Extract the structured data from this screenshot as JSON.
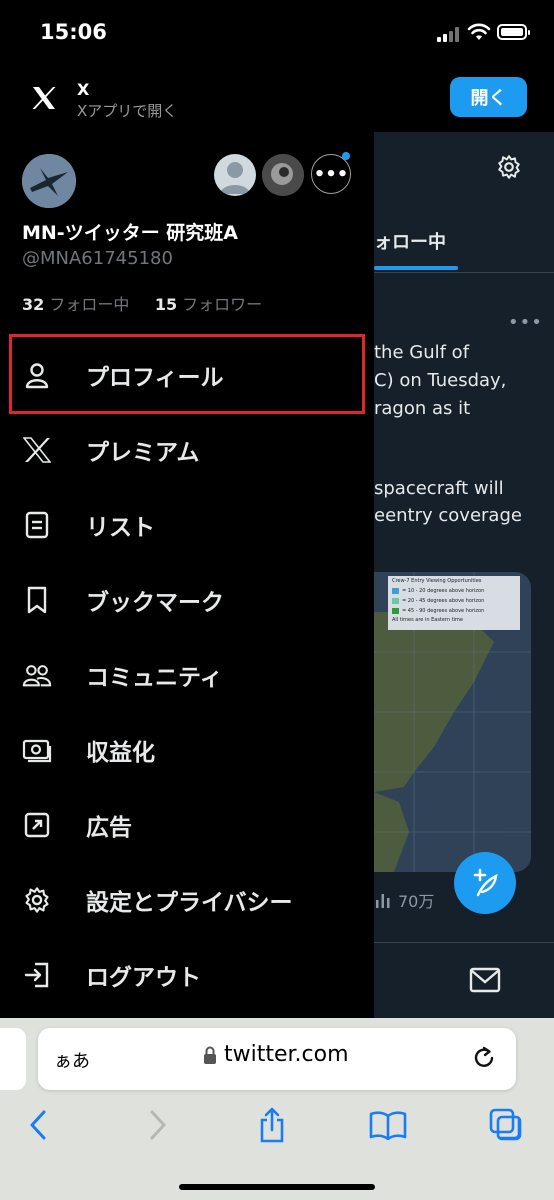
{
  "status_bar": {
    "time": "15:06"
  },
  "app_banner": {
    "app_name": "X",
    "subtitle": "Xアプリで開く",
    "open_label": "開く"
  },
  "profile": {
    "display_name": "MN-ツイッター 研究班A",
    "handle": "@MNA61745180",
    "following_count": "32",
    "following_label": "フォロー中",
    "followers_count": "15",
    "followers_label": "フォロワー"
  },
  "menu": {
    "items": [
      {
        "label": "プロフィール",
        "icon": "person-icon"
      },
      {
        "label": "プレミアム",
        "icon": "x-logo-icon"
      },
      {
        "label": "リスト",
        "icon": "list-icon"
      },
      {
        "label": "ブックマーク",
        "icon": "bookmark-icon"
      },
      {
        "label": "コミュニティ",
        "icon": "communities-icon"
      },
      {
        "label": "収益化",
        "icon": "monetization-icon"
      },
      {
        "label": "広告",
        "icon": "ads-icon"
      },
      {
        "label": "設定とプライバシー",
        "icon": "gear-icon"
      },
      {
        "label": "ログアウト",
        "icon": "logout-icon"
      }
    ]
  },
  "background": {
    "tab_label": "フォロー中",
    "tweet_lines": [
      "the Gulf of",
      "C) on Tuesday,",
      "ragon as it",
      "spacecraft will",
      "eentry coverage"
    ],
    "views": "70万",
    "map_legend": {
      "title": "Crew-7 Entry Viewing Opportunities",
      "rows": [
        "= 10 - 20 degrees above horizon",
        "= 20 - 45 degrees above horizon",
        "= 45 - 90 degrees above horizon"
      ],
      "footer": "All times are in Eastern time"
    }
  },
  "browser": {
    "aa_label": "ぁあ",
    "url": "twitter.com"
  },
  "colors": {
    "accent": "#1d9bf0",
    "highlight": "#e0262b",
    "drawer_bg": "#000000",
    "timeline_bg": "#15202b"
  }
}
